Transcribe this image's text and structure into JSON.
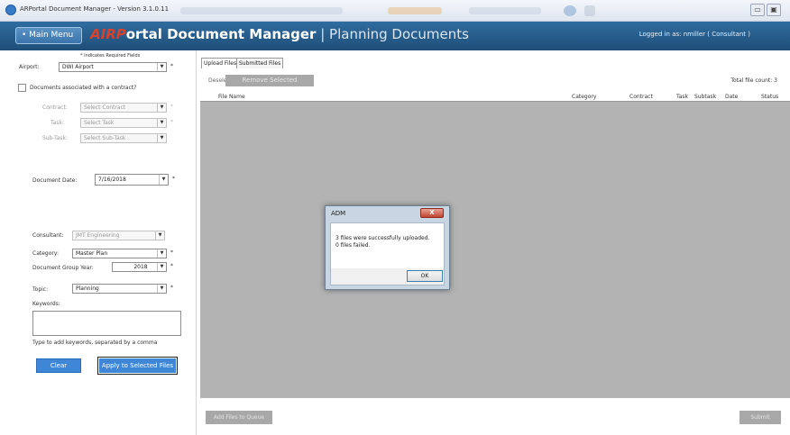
{
  "window": {
    "title": "ARPortal Document Manager - Version 3.1.0.11",
    "controls": {
      "minimize": "▭",
      "maximize": "▣"
    }
  },
  "header": {
    "main_menu": "• Main Menu",
    "logo_prefix": "AIRP",
    "title_main": "ortal Document Manager",
    "title_separator": " | ",
    "title_sub": "Planning Documents",
    "logged_in": "Logged in as: nmiller ( Consultant )"
  },
  "form": {
    "required_note": "* Indicates Required Fields",
    "airport_label": "Airport:",
    "airport_value": "DWI Airport",
    "contract_checkbox_label": "Documents associated with a contract?",
    "contract_label": "Contract:",
    "contract_value": "Select Contract",
    "task_label": "Task:",
    "task_value": "Select Task",
    "subtask_label": "Sub-Task:",
    "subtask_value": "Select Sub-Task",
    "doc_date_label": "Document Date:",
    "doc_date_value": "7/16/2018",
    "consultant_label": "Consultant:",
    "consultant_value": "JMT Engineering",
    "category_label": "Category:",
    "category_value": "Master Plan",
    "group_year_label": "Document Group Year:",
    "group_year_value": "2018",
    "topic_label": "Topic:",
    "topic_value": "Planning",
    "keywords_label": "Keywords:",
    "keywords_hint": "Type to add keywords, separated by a comma",
    "clear_button": "Clear",
    "apply_button": "Apply to Selected Files",
    "required_star": "*",
    "dropdown_arrow": "▼"
  },
  "files": {
    "tabs": [
      "Upload Files",
      "Submitted Files"
    ],
    "deselect_all": "Deselect All",
    "remove_selected": "Remove Selected",
    "total_count": "Total file count: 3",
    "columns": [
      "File Name",
      "Category",
      "Contract",
      "Task",
      "Subtask",
      "Date",
      "Status"
    ],
    "add_files_button": "Add Files to Queue",
    "submit_button": "Submit"
  },
  "dialog": {
    "title": "ADM",
    "close": "X",
    "message_line1": "3 files were successfully uploaded.",
    "message_line2": "0 files failed.",
    "ok_button": "OK"
  },
  "colors": {
    "header_bg": "#1f4e78",
    "logo_accent": "#d8412b",
    "primary_button": "#3f86d6",
    "disabled_button": "#a8a8a8",
    "grid_bg": "#b3b3b3"
  }
}
